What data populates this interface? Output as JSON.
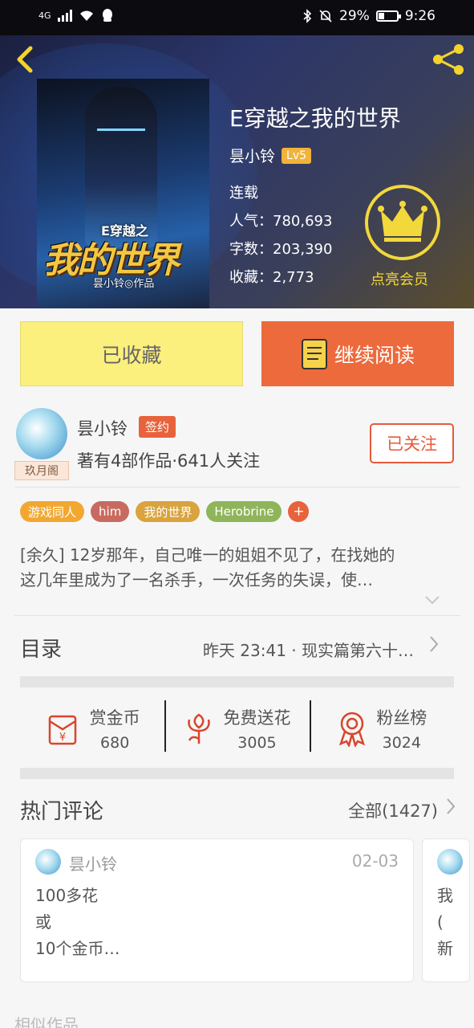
{
  "status_bar": {
    "network": "4G",
    "battery": "29%",
    "time": "9:26"
  },
  "header": {
    "back_icon": "chevron-left-icon",
    "share_icon": "share-icon"
  },
  "book": {
    "title": "E穿越之我的世界",
    "author": "昙小铃",
    "level": "Lv5",
    "status": "连载",
    "popularity": "人气：780,693",
    "word_count": "字数：203,390",
    "favorites": "收藏：2,773",
    "cover": {
      "small_title": "E穿越之",
      "big_title": "我的世界",
      "author_line": "昙小铃◎作品"
    },
    "vip_label": "点亮会员"
  },
  "buttons": {
    "collected": "已收藏",
    "continue_reading": "继续阅读"
  },
  "author_info": {
    "name": "昙小铃",
    "badge": "签约",
    "avatar_tag": "玖月阁",
    "description": "著有4部作品·641人关注",
    "follow_button": "已关注"
  },
  "tags": [
    {
      "label": "游戏同人",
      "color": "#f2a830"
    },
    {
      "label": "him",
      "color": "#c86a60"
    },
    {
      "label": "我的世界",
      "color": "#d9a33e"
    },
    {
      "label": "Herobrine",
      "color": "#8fb55a"
    }
  ],
  "tag_more": "+",
  "synopsis": {
    "line1": "[余久] 12岁那年，自己唯一的姐姐不见了，在找她的",
    "line2": "这几年里成为了一名杀手，一次任务的失误，使…"
  },
  "toc": {
    "label": "目录",
    "latest": "昨天 23:41 · 现实篇第六十…"
  },
  "support_actions": [
    {
      "label": "赏金币",
      "count": "680",
      "icon": "red-envelope-icon"
    },
    {
      "label": "免费送花",
      "count": "3005",
      "icon": "flower-icon"
    },
    {
      "label": "粉丝榜",
      "count": "3024",
      "icon": "award-ribbon-icon"
    }
  ],
  "comments": {
    "title": "热门评论",
    "all_label": "全部(1427)",
    "items": [
      {
        "user": "昙小铃",
        "date": "02-03",
        "text": "100多花\n或\n10个金币…"
      },
      {
        "user": "",
        "date": "",
        "text": "我\n(\n新"
      }
    ]
  },
  "similar_title": "相似作品",
  "colors": {
    "accent_yellow": "#f2d83b",
    "accent_orange": "#ec6a3c",
    "collected_bg": "#fbef7e"
  }
}
